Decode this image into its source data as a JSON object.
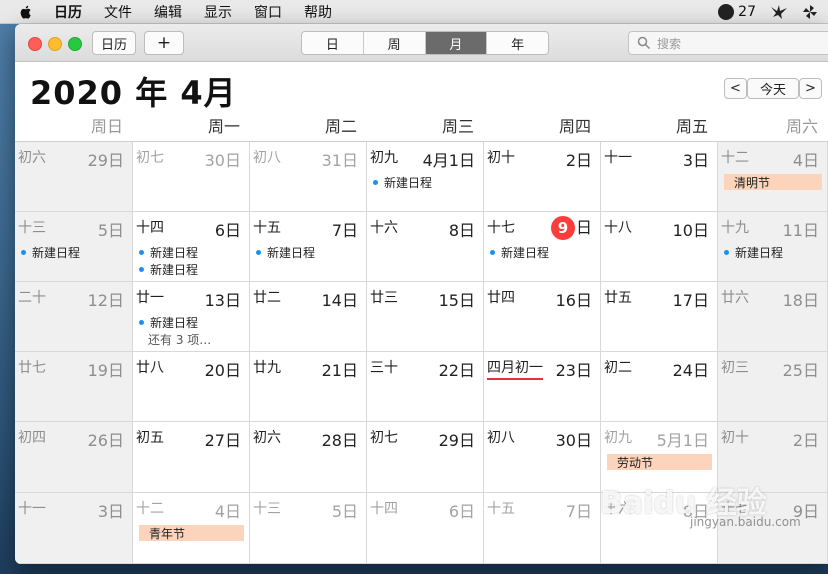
{
  "menubar": {
    "app_name": "日历",
    "items": [
      "文件",
      "编辑",
      "显示",
      "窗口",
      "帮助"
    ],
    "weather_temp": "27"
  },
  "toolbar": {
    "calendars_label": "日历",
    "add_label": "+",
    "views": [
      "日",
      "周",
      "月",
      "年"
    ],
    "active_view": "月",
    "search_placeholder": "搜索"
  },
  "header": {
    "title": "2020 年 4月",
    "prev_label": "<",
    "today_label": "今天",
    "next_label": ">"
  },
  "weekdays": [
    "周日",
    "周一",
    "周二",
    "周三",
    "周四",
    "周五",
    "周六"
  ],
  "weeks": [
    [
      {
        "lunar": "初六",
        "day": "29日",
        "other": true
      },
      {
        "lunar": "初七",
        "day": "30日",
        "other": true
      },
      {
        "lunar": "初八",
        "day": "31日",
        "other": true
      },
      {
        "lunar": "初九",
        "day": "4月1日",
        "events": [
          "新建日程"
        ]
      },
      {
        "lunar": "初十",
        "day": "2日"
      },
      {
        "lunar": "十一",
        "day": "3日"
      },
      {
        "lunar": "十二",
        "day": "4日",
        "holiday": "清明节"
      }
    ],
    [
      {
        "lunar": "十三",
        "day": "5日",
        "events": [
          "新建日程"
        ]
      },
      {
        "lunar": "十四",
        "day": "6日",
        "events": [
          "新建日程",
          "新建日程"
        ]
      },
      {
        "lunar": "十五",
        "day": "7日",
        "events": [
          "新建日程"
        ]
      },
      {
        "lunar": "十六",
        "day": "8日"
      },
      {
        "lunar": "十七",
        "day": "日",
        "today_num": "9",
        "events": [
          "新建日程"
        ]
      },
      {
        "lunar": "十八",
        "day": "10日"
      },
      {
        "lunar": "十九",
        "day": "11日",
        "events": [
          "新建日程"
        ]
      }
    ],
    [
      {
        "lunar": "二十",
        "day": "12日"
      },
      {
        "lunar": "廿一",
        "day": "13日",
        "events": [
          "新建日程"
        ],
        "more": "还有 3 项…"
      },
      {
        "lunar": "廿二",
        "day": "14日"
      },
      {
        "lunar": "廿三",
        "day": "15日"
      },
      {
        "lunar": "廿四",
        "day": "16日"
      },
      {
        "lunar": "廿五",
        "day": "17日"
      },
      {
        "lunar": "廿六",
        "day": "18日"
      }
    ],
    [
      {
        "lunar": "廿七",
        "day": "19日"
      },
      {
        "lunar": "廿八",
        "day": "20日"
      },
      {
        "lunar": "廿九",
        "day": "21日"
      },
      {
        "lunar": "三十",
        "day": "22日"
      },
      {
        "lunar": "四月初一",
        "day": "23日",
        "underline": true
      },
      {
        "lunar": "初二",
        "day": "24日"
      },
      {
        "lunar": "初三",
        "day": "25日"
      }
    ],
    [
      {
        "lunar": "初四",
        "day": "26日"
      },
      {
        "lunar": "初五",
        "day": "27日"
      },
      {
        "lunar": "初六",
        "day": "28日"
      },
      {
        "lunar": "初七",
        "day": "29日"
      },
      {
        "lunar": "初八",
        "day": "30日"
      },
      {
        "lunar": "初九",
        "day": "5月1日",
        "other": true,
        "holiday": "劳动节"
      },
      {
        "lunar": "初十",
        "day": "2日",
        "other": true
      }
    ],
    [
      {
        "lunar": "十一",
        "day": "3日",
        "other": true
      },
      {
        "lunar": "十二",
        "day": "4日",
        "other": true,
        "holiday": "青年节"
      },
      {
        "lunar": "十三",
        "day": "5日",
        "other": true
      },
      {
        "lunar": "十四",
        "day": "6日",
        "other": true
      },
      {
        "lunar": "十五",
        "day": "7日",
        "other": true
      },
      {
        "lunar": "十六",
        "day": "8日",
        "other": true
      },
      {
        "lunar": "十七",
        "day": "9日",
        "other": true
      }
    ]
  ],
  "watermark": {
    "text": "Baidu 经验",
    "sub": "jingyan.baidu.com"
  },
  "colors": {
    "today": "#fc3d39",
    "event_dot": "#1b8ff5",
    "holiday_bg": "#fcd3bb",
    "active_segment": "#6b6b6b"
  }
}
